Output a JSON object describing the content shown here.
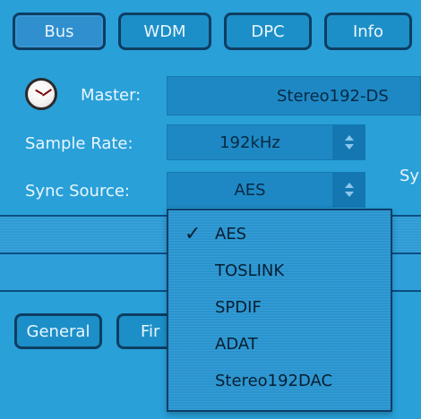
{
  "tabs": [
    {
      "label": "Bus"
    },
    {
      "label": "WDM"
    },
    {
      "label": "DPC"
    },
    {
      "label": "Info"
    }
  ],
  "master": {
    "label": "Master:",
    "value": "Stereo192-DS"
  },
  "sample_rate": {
    "label": "Sample Rate:",
    "value": "192kHz"
  },
  "sync_source": {
    "label": "Sync Source:",
    "value": "AES"
  },
  "right_fragment": "Sy",
  "dropdown": {
    "options": [
      {
        "label": "AES",
        "selected": true
      },
      {
        "label": "TOSLINK"
      },
      {
        "label": "SPDIF"
      },
      {
        "label": "ADAT"
      },
      {
        "label": "Stereo192DAC"
      }
    ]
  },
  "bottom_tabs": {
    "general": "General",
    "first_partial": "Fir"
  },
  "colors": {
    "background": "#29a0d8",
    "tab_border": "#0d3e62",
    "text_light": "#e8f6ff",
    "text_dark": "#061f33"
  }
}
